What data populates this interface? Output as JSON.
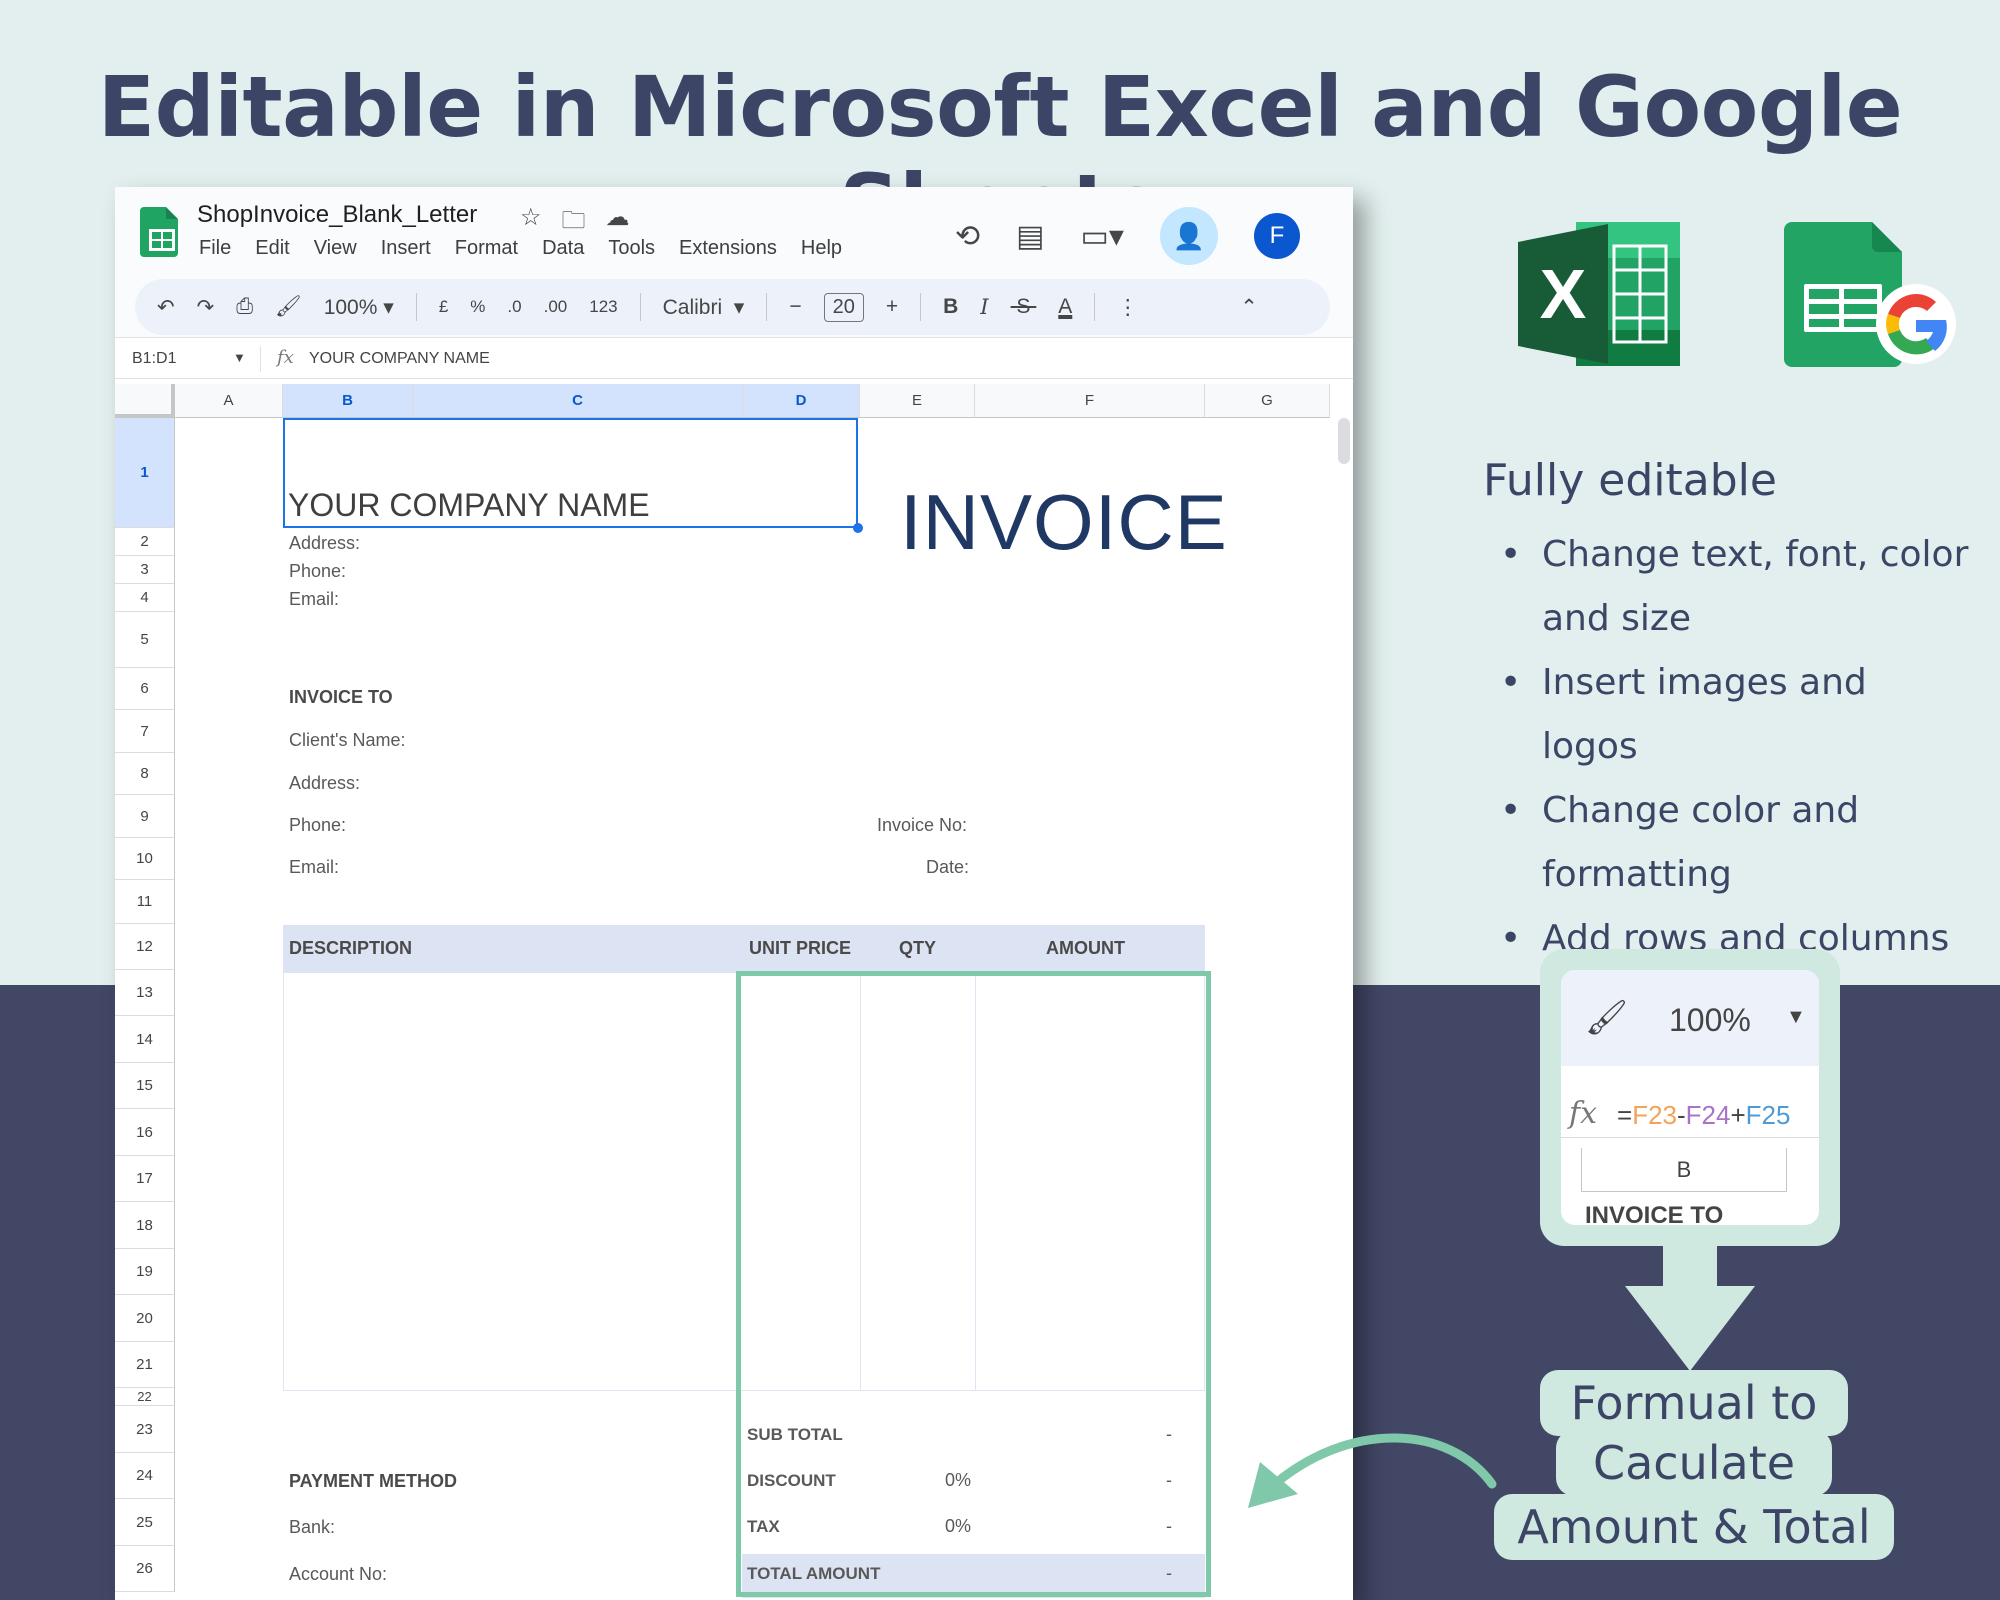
{
  "headline": "Editable in Microsoft Excel and Google Sheets",
  "window": {
    "doc_title": "ShopInvoice_Blank_Letter",
    "menu": [
      "File",
      "Edit",
      "View",
      "Insert",
      "Format",
      "Data",
      "Tools",
      "Extensions",
      "Help"
    ],
    "avatar_letter": "F",
    "toolbar": {
      "zoom": "100%",
      "currency": "£",
      "percent": "%",
      "dec_decrease": ".0",
      "dec_increase": ".00",
      "number_format": "123",
      "font": "Calibri",
      "font_size": "20",
      "bold": "B",
      "italic": "I",
      "text_color": "A"
    },
    "formula_bar": {
      "name_box": "B1:D1",
      "fx": "fx",
      "value": "YOUR COMPANY NAME"
    },
    "columns": [
      "A",
      "B",
      "C",
      "D",
      "E",
      "F",
      "G"
    ],
    "rows": [
      "1",
      "2",
      "3",
      "4",
      "5",
      "6",
      "7",
      "8",
      "9",
      "10",
      "11",
      "12",
      "13",
      "14",
      "15",
      "16",
      "17",
      "18",
      "19",
      "20",
      "21",
      "22",
      "23",
      "24",
      "25",
      "26"
    ],
    "invoice": {
      "company_name": "YOUR COMPANY NAME",
      "title": "INVOICE",
      "address": "Address:",
      "phone": "Phone:",
      "email": "Email:",
      "invoice_to": "INVOICE TO",
      "client_name": "Client's Name:",
      "client_address": "Address:",
      "client_phone": "Phone:",
      "client_email": "Email:",
      "invoice_no": "Invoice No:",
      "date": "Date:",
      "table_headers": [
        "DESCRIPTION",
        "UNIT PRICE",
        "QTY",
        "AMOUNT"
      ],
      "sub_total": "SUB TOTAL",
      "discount": "DISCOUNT",
      "tax": "TAX",
      "total_amount": "TOTAL AMOUNT",
      "discount_pct": "0%",
      "tax_pct": "0%",
      "dash": "-",
      "payment_method": "PAYMENT METHOD",
      "bank": "Bank:",
      "account_no": "Account No:"
    }
  },
  "features": {
    "title": "Fully editable",
    "items": [
      "Change text, font, color and size",
      "Insert images and logos",
      "Change color and formatting",
      "Add rows and columns"
    ]
  },
  "zoom_card": {
    "zoom": "100%",
    "fx": "fx",
    "formula_parts": [
      {
        "text": "=",
        "color": "#444444"
      },
      {
        "text": "F23",
        "color": "#f4a259"
      },
      {
        "text": "-",
        "color": "#444444"
      },
      {
        "text": "F24",
        "color": "#a874c9"
      },
      {
        "text": "+",
        "color": "#444444"
      },
      {
        "text": "F25",
        "color": "#4f9bd9"
      }
    ],
    "column": "B",
    "cut_text": "INVOICE TO"
  },
  "formula_note": [
    "Formual to",
    "Caculate",
    "Amount & Total"
  ],
  "colors": {
    "bg_light": "#e2efee",
    "bg_dark": "#424766",
    "heading": "#3d4566",
    "accent_green": "#7fc8a9",
    "card_mint": "#cfe9e0",
    "invoice_navy": "#1f3864",
    "table_header": "#dce3f2"
  }
}
